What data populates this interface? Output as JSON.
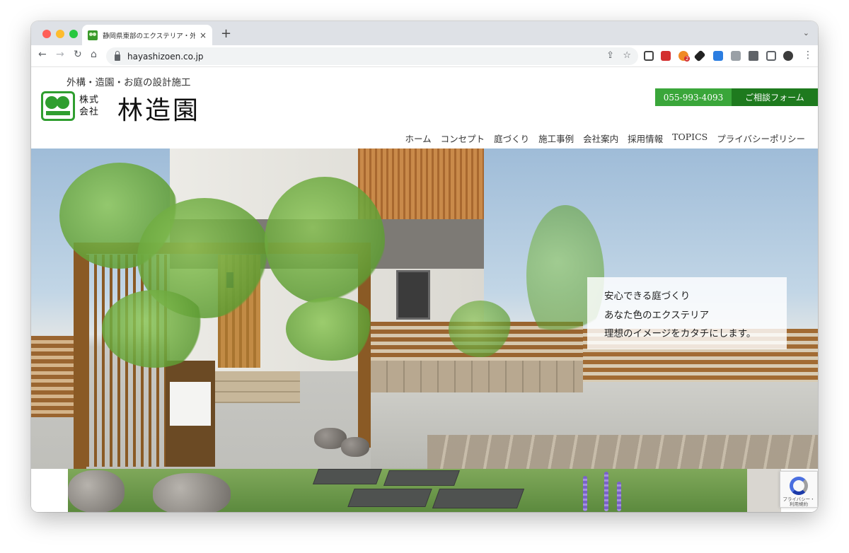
{
  "browser": {
    "tab_title": "静岡県東部のエクステリア・外構",
    "tab_close": "×",
    "new_tab": "+",
    "tab_menu": "⌄",
    "url": "hayashizoen.co.jp",
    "nav": {
      "back": "←",
      "forward": "→",
      "reload": "↻",
      "home": "⌂"
    },
    "omni_icons": {
      "share": "⇪",
      "star": "☆"
    },
    "extension_badge": "2",
    "menu": "⋮",
    "colors": {
      "tabbar": "#dee1e6",
      "close": "#ff5f57",
      "minimize": "#febc2e",
      "maximize": "#28c840"
    }
  },
  "site": {
    "tagline": "外構・造園・お庭の設計施工",
    "company_prefix": "株式会社",
    "company_name": "林造園",
    "phone": "055-993-4093",
    "consult_label": "ご相談フォーム",
    "nav": [
      "ホーム",
      "コンセプト",
      "庭づくり",
      "施工事例",
      "会社案内",
      "採用情報",
      "TOPICS",
      "プライバシーポリシー"
    ],
    "colors": {
      "brand_green": "#3aa63a",
      "dark_green": "#1e7a1e"
    }
  },
  "hero": {
    "lines": [
      "安心できる庭づくり",
      "あなた色のエクステリア",
      "理想のイメージをカタチにします。"
    ]
  },
  "recaptcha": {
    "line1": "プライバシー・",
    "line2": "利用規約"
  }
}
